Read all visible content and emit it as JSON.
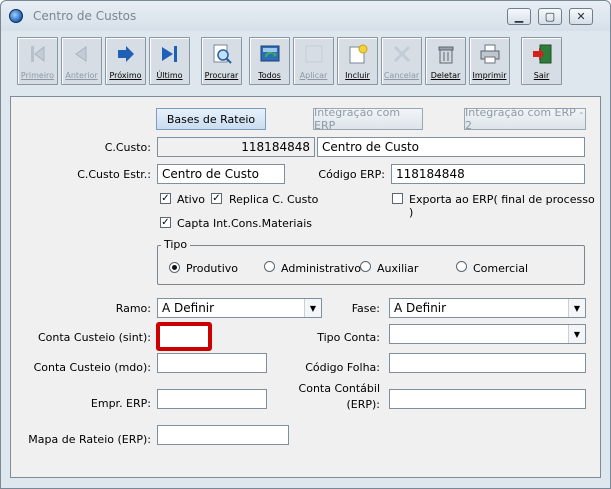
{
  "window": {
    "title": "Centro de Custos",
    "controls": {
      "minimize": "▁",
      "maximize": "▢",
      "close": "✕"
    }
  },
  "toolbar": {
    "buttons": [
      {
        "label": "Primeiro",
        "icon": "first-record-icon",
        "enabled": false
      },
      {
        "label": "Anterior",
        "icon": "previous-record-icon",
        "enabled": false
      },
      {
        "label": "Próximo",
        "icon": "next-record-icon",
        "enabled": true
      },
      {
        "label": "Último",
        "icon": "last-record-icon",
        "enabled": true
      },
      {
        "label": "Procurar",
        "icon": "search-icon",
        "enabled": true
      },
      {
        "label": "Todos",
        "icon": "refresh-all-icon",
        "enabled": true
      },
      {
        "label": "Aplicar",
        "icon": "apply-icon",
        "enabled": false
      },
      {
        "label": "Incluir",
        "icon": "new-document-icon",
        "enabled": true
      },
      {
        "label": "Cancelar",
        "icon": "cancel-icon",
        "enabled": false
      },
      {
        "label": "Deletar",
        "icon": "trash-icon",
        "enabled": true
      },
      {
        "label": "Imprimir",
        "icon": "printer-icon",
        "enabled": true
      },
      {
        "label": "Sair",
        "icon": "exit-door-icon",
        "enabled": true
      }
    ]
  },
  "tabs": {
    "bases_rateio": "Bases de Rateio",
    "integracao_erp": "Integração com ERP",
    "integracao_erp_2": "Integração com ERP - 2"
  },
  "form": {
    "ccusto_label": "C.Custo:",
    "ccusto_code": "118184848",
    "ccusto_name": "Centro de Custo",
    "ccusto_estr_label": "C.Custo Estr.:",
    "ccusto_estr_value": "Centro de Custo",
    "codigo_erp_label": "Código ERP:",
    "codigo_erp_value": "118184848",
    "ativo_label": "Ativo",
    "ativo_checked": true,
    "replica_label": "Replica C. Custo",
    "replica_checked": true,
    "exporta_label": "Exporta ao ERP( final de processo )",
    "exporta_checked": false,
    "capta_label": "Capta Int.Cons.Materiais",
    "capta_checked": true,
    "tipo_label": "Tipo",
    "tipo_options": [
      "Produtivo",
      "Administrativo",
      "Auxiliar",
      "Comercial"
    ],
    "tipo_selected": "Produtivo",
    "ramo_label": "Ramo:",
    "ramo_value": "A Definir",
    "fase_label": "Fase:",
    "fase_value": "A Definir",
    "conta_custeio_sint_label": "Conta Custeio (sint):",
    "conta_custeio_sint_value": "",
    "tipo_conta_label": "Tipo Conta:",
    "tipo_conta_value": "",
    "conta_custeio_mdo_label": "Conta Custeio (mdo):",
    "conta_custeio_mdo_value": "",
    "codigo_folha_label": "Código Folha:",
    "codigo_folha_value": "",
    "empr_erp_label": "Empr. ERP:",
    "empr_erp_value": "",
    "conta_contabil_label_1": "Conta Contábil",
    "conta_contabil_label_2": "(ERP):",
    "conta_contabil_value": "",
    "mapa_rateio_label": "Mapa de Rateio (ERP):",
    "mapa_rateio_value": ""
  },
  "colors": {
    "highlight": "#cc0000"
  }
}
